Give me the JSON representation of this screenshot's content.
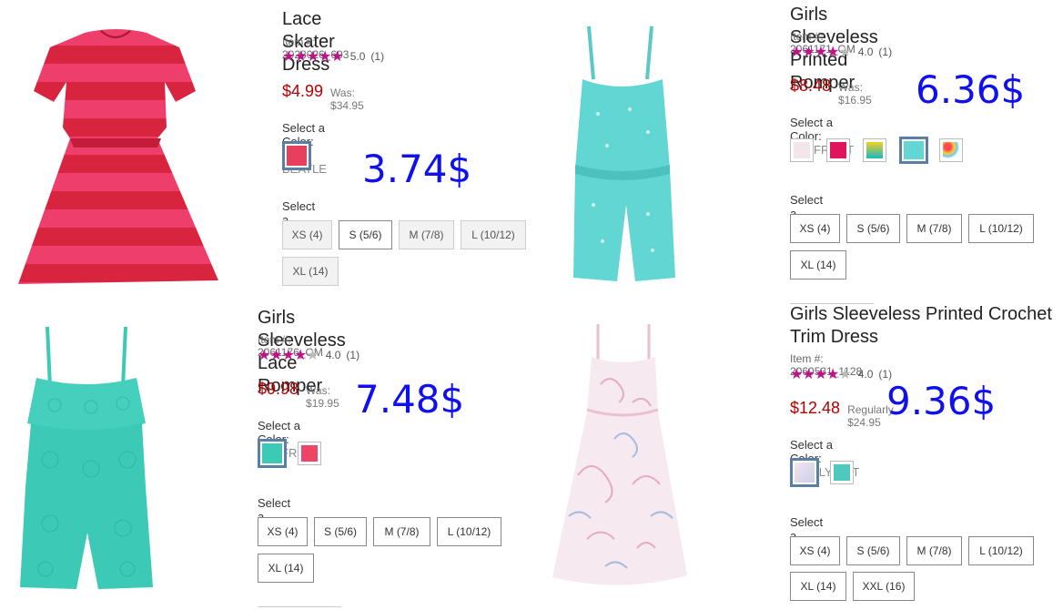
{
  "products": [
    {
      "title": "Lace Skater Dress",
      "item": "Item #: 2028026_693",
      "rating_value": 5,
      "rating_text": "5.0",
      "rating_count": "(1)",
      "price": "$4.99",
      "was": "Was: $34.95",
      "color_label": "Select a Color:",
      "color_value": "RED BEATLE",
      "size_label": "Select a Size:",
      "sizes": [
        "XS (4)",
        "S (5/6)",
        "M (7/8)",
        "L (10/12)",
        "XL (14)"
      ],
      "annotation": "3.74$"
    },
    {
      "title": "Girls Sleeveless Printed Romper",
      "item": "Item #: 2061171_OM",
      "rating_value": 4,
      "rating_text": "4.0",
      "rating_count": "(1)",
      "price": "$8.48",
      "was": "Was: $16.95",
      "color_label": "Select a Color:",
      "color_value": "SEAFROST",
      "size_label": "Select a Size:",
      "sizes": [
        "XS (4)",
        "S (5/6)",
        "M (7/8)",
        "L (10/12)",
        "XL (14)"
      ],
      "annotation": "6.36$"
    },
    {
      "title": "Girls Sleeveless Lace Romper",
      "item": "Item #: 2061176_OM",
      "rating_value": 4,
      "rating_text": "4.0",
      "rating_count": "(1)",
      "price": "$9.98",
      "was": "Was: $19.95",
      "color_label": "Select a Color:",
      "color_value": "SEAFROST",
      "size_label": "Select a Size:",
      "sizes": [
        "XS (4)",
        "S (5/6)",
        "M (7/8)",
        "L (10/12)",
        "XL (14)"
      ],
      "annotation": "7.48$"
    },
    {
      "title": "Girls Sleeveless Printed Crochet Trim Dress",
      "item": "Item #: 2060531_1128",
      "rating_value": 4,
      "rating_text": "4.0",
      "rating_count": "(1)",
      "price": "$12.48",
      "was": "Regularly $24.95",
      "color_label": "Select a Color:",
      "color_value": "SIMPLYWHT",
      "size_label": "Select a Size:",
      "sizes": [
        "XS (4)",
        "S (5/6)",
        "M (7/8)",
        "L (10/12)",
        "XL (14)",
        "XXL (16)"
      ],
      "annotation": "9.36$"
    }
  ],
  "colors": {
    "star": "#c0108a",
    "price": "#b40000",
    "annotation": "#1010ee",
    "swatch_active_border": "#5b7fa3"
  },
  "icons": [
    "star-icon"
  ]
}
